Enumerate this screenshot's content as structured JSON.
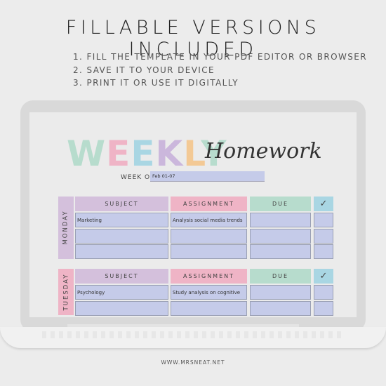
{
  "headline": "FILLABLE VERSIONS INCLUDED",
  "steps": [
    "1. FILL THE TEMPLATE IN YOUR PDF EDITOR OR BROWSER",
    "2. SAVE IT TO YOUR DEVICE",
    "3. PRINT IT OR USE IT DIGITALLY"
  ],
  "planner": {
    "title_letters": [
      {
        "char": "W",
        "color": "#b7dccd"
      },
      {
        "char": "E",
        "color": "#efb4c6"
      },
      {
        "char": "E",
        "color": "#a9d6e3"
      },
      {
        "char": "K",
        "color": "#cbb7dc"
      },
      {
        "char": "L",
        "color": "#f3c995"
      },
      {
        "char": "Y",
        "color": "#b7dccd"
      }
    ],
    "subtitle": "Homework",
    "week_of_label": "WEEK OF:",
    "week_of_value": "Feb 01-07",
    "columns": {
      "subject": "SUBJECT",
      "assignment": "ASSIGNMENT",
      "due": "DUE",
      "check": "✓"
    },
    "colors": {
      "subject_header": "#d4c0dc",
      "assignment_header": "#efb4c6",
      "due_header": "#b7dccd",
      "check_header": "#a9d6e3",
      "monday": "#d4c0dc",
      "tuesday": "#efb4c6",
      "field": "#c5cbe9"
    },
    "days": [
      {
        "name": "MONDAY",
        "rows": [
          {
            "subject": "Marketing",
            "assignment": "Analysis social media trends",
            "due": "",
            "done": ""
          },
          {
            "subject": "",
            "assignment": "",
            "due": "",
            "done": ""
          },
          {
            "subject": "",
            "assignment": "",
            "due": "",
            "done": ""
          }
        ]
      },
      {
        "name": "TUESDAY",
        "rows": [
          {
            "subject": "Psychology",
            "assignment": "Study analysis on cognitive",
            "due": "",
            "done": ""
          },
          {
            "subject": "",
            "assignment": "",
            "due": "",
            "done": ""
          }
        ]
      }
    ]
  },
  "footer": "WWW.MRSNEAT.NET"
}
